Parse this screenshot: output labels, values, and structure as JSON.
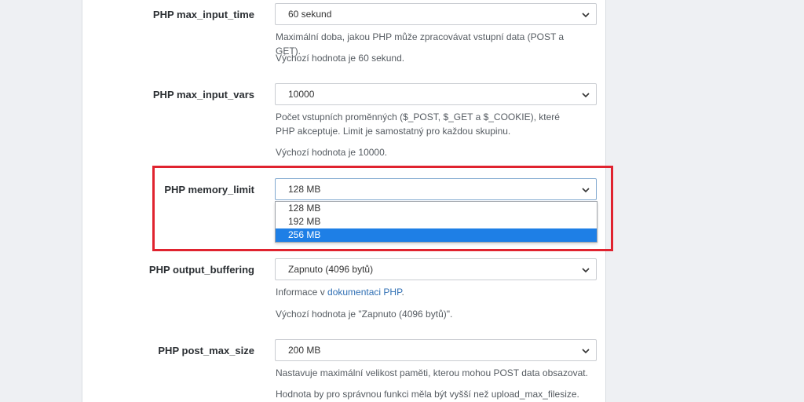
{
  "settings": [
    {
      "label": "PHP max_input_time",
      "value": "60 sekund",
      "help": [
        "Maximální doba, jakou PHP může zpracovávat vstupní data (POST a GET).",
        "Výchozí hodnota je 60 sekund."
      ]
    },
    {
      "label": "PHP max_input_vars",
      "value": "10000",
      "help": [
        "Počet vstupních proměnných ($_POST, $_GET a $_COOKIE), které PHP akceptuje. Limit je samostatný pro každou skupinu.",
        "Výchozí hodnota je 10000."
      ]
    },
    {
      "label": "PHP memory_limit",
      "value": "128 MB",
      "options": [
        "128 MB",
        "192 MB",
        "256 MB"
      ],
      "highlighted_option": "256 MB"
    },
    {
      "label": "PHP output_buffering",
      "value": "Zapnuto (4096 bytů)",
      "help_prefix": "Informace v ",
      "help_link": "dokumentaci PHP",
      "help_suffix": ".",
      "help": [
        "Výchozí hodnota je \"Zapnuto (4096 bytů)\"."
      ]
    },
    {
      "label": "PHP post_max_size",
      "value": "200 MB",
      "help": [
        "Nastavuje maximální velikost paměti, kterou mohou POST data obsazovat.",
        "Hodnota by pro správnou funkci měla být vyšší než upload_max_filesize."
      ]
    }
  ],
  "colors": {
    "highlight_border": "#e0232f",
    "selected_option_bg": "#1e7fe6",
    "link": "#2f6fb4"
  },
  "icons": {
    "select_arrow": "chevron-down-icon"
  }
}
